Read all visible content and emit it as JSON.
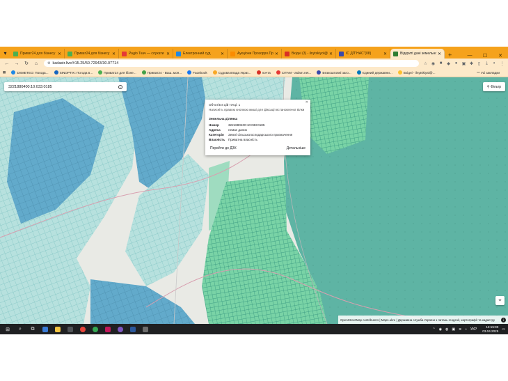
{
  "browser": {
    "tabs": [
      {
        "label": "Приват24 для бізнесу",
        "color": "#4caf50"
      },
      {
        "label": "Приват24 для бізнесу",
        "color": "#4caf50"
      },
      {
        "label": "Радіо Ткач — слухати",
        "color": "#e53935"
      },
      {
        "label": "Електронний суд",
        "color": "#1e88e5"
      },
      {
        "label": "Аукціони Прозорро.Продажі",
        "color": "#fb8c00"
      },
      {
        "label": "Вхідні (3) - ilnytskiyol@",
        "color": "#d93025"
      },
      {
        "label": "IC ДП\"НАС\"(08)",
        "color": "#3949ab"
      },
      {
        "label": "Відкриті дані земельного кадастру",
        "color": "#2e7d32"
      }
    ],
    "url": "kadastr.live/#15.25/50.72943/30.07714",
    "bookmarks": [
      {
        "label": "DSMETEO: Погода...",
        "color": "#1e88e5"
      },
      {
        "label": "SINOPTIK: Погода в...",
        "color": "#1565c0"
      },
      {
        "label": "Приват24 для бізне...",
        "color": "#4caf50"
      },
      {
        "label": "Приват24 - Ваш..моя...",
        "color": "#43a047"
      },
      {
        "label": "Facebook",
        "color": "#1877f2"
      },
      {
        "label": "Судова влада Украї...",
        "color": "#f9a825"
      },
      {
        "label": "почта",
        "color": "#d93025"
      },
      {
        "label": "CITAM - aslam.net...",
        "color": "#e53935"
      },
      {
        "label": "Безкоштовні заго...",
        "color": "#3949ab"
      },
      {
        "label": "Єдиний державни...",
        "color": "#0277bd"
      },
      {
        "label": "Вхідні - ilnytskiyal@...",
        "color": "#fbc02d"
      }
    ],
    "all_bookmarks": "Усі закладки"
  },
  "map": {
    "search_value": "3221880400:10:033:0185",
    "filter_label": "Фільтр",
    "attribution": "OpenStreetMap contributors | Maps.ukre | Державна служба України з питань геодезії, картографії та кадастру"
  },
  "popup": {
    "count": "Об'єктів в цій точці: 1",
    "hint": "Натисніть правою кнопкою миші для фіксації встановленої вілки",
    "section": "Земельна ділянка",
    "rows": [
      {
        "key": "Номер",
        "value": "3221880400:10:033:0185"
      },
      {
        "key": "Адреса",
        "value": "немає даних"
      },
      {
        "key": "Категорія",
        "value": "Землі сільськогосподарського призначення"
      },
      {
        "key": "Власність",
        "value": "Приватна власність"
      }
    ],
    "goto_label": "Перейти до ДЗК",
    "details_label": "Детальніше"
  },
  "taskbar": {
    "language": "УКР",
    "time": "13:15:00",
    "date": "03.04.2025"
  },
  "colors": {
    "parcel_dark": "#62aacb",
    "parcel_light": "#b7e1de",
    "parcel_green": "#79d3a6",
    "forest": "#5eb4a4",
    "tabstrip": "#f5a21c"
  }
}
